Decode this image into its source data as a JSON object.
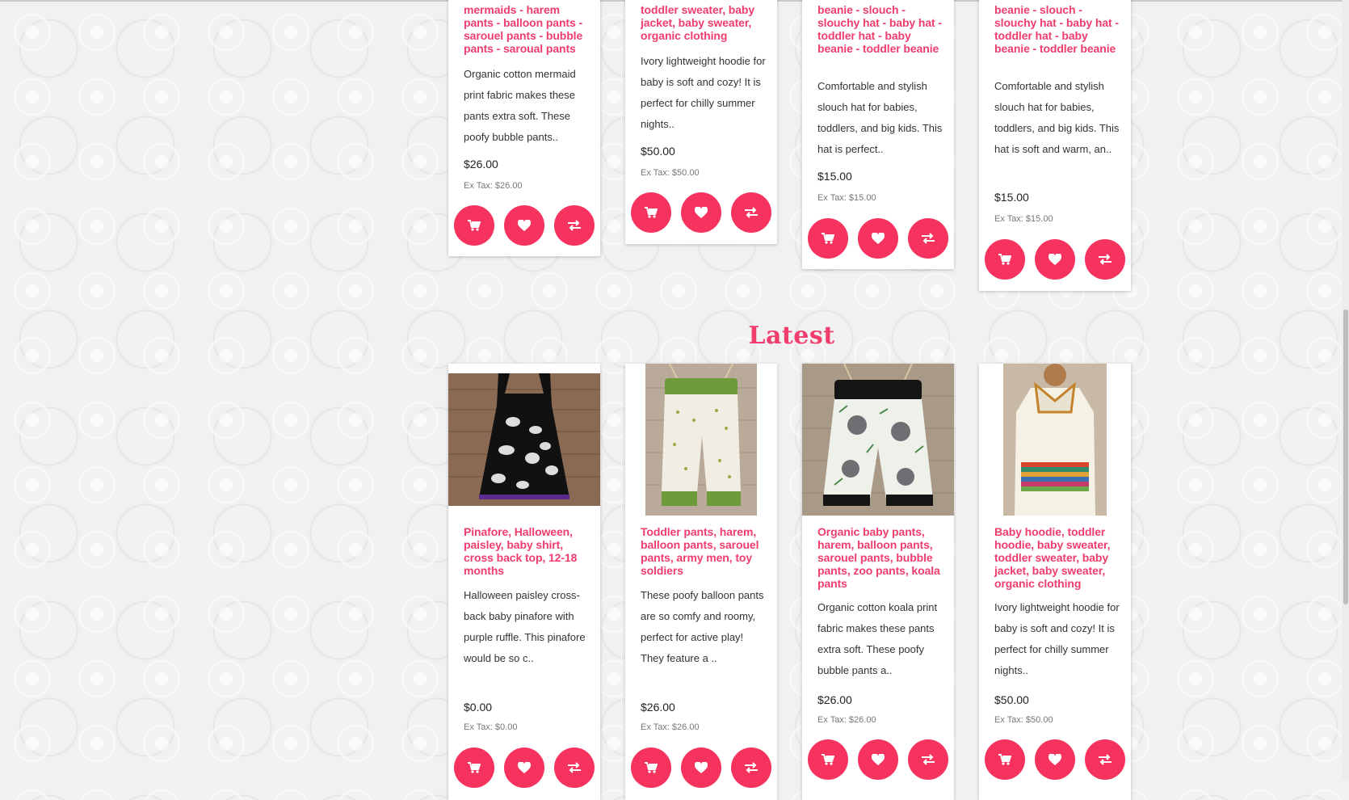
{
  "section_heading": "Latest",
  "colors": {
    "accent": "#f6335f",
    "title": "#f03d6b"
  },
  "top_row": [
    {
      "name_partial": "baby pants - mermaids - harem pants - balloon pants - sarouel pants - bubble pants - saroual pants",
      "name": "mermaids - harem pants - balloon pants - sarouel pants - bubble pants - saroual pants",
      "description": "Organic cotton mermaid print fabric makes these pants extra soft. These poofy bubble pants..",
      "price": "$26.00",
      "ex_tax": "Ex Tax: $26.00"
    },
    {
      "name": "toddler sweater, baby jacket, baby sweater, organic clothing",
      "description": "Ivory lightweight hoodie for baby is soft and cozy! It is perfect for chilly summer nights..",
      "price": "$50.00",
      "ex_tax": "Ex Tax: $50.00"
    },
    {
      "name": "beanie - slouch - slouchy hat - baby hat - toddler hat - baby beanie - toddler beanie",
      "description": "Comfortable and stylish slouch hat for babies, toddlers, and big kids. This hat is perfect..",
      "price": "$15.00",
      "ex_tax": "Ex Tax: $15.00"
    },
    {
      "name": "beanie - slouch - slouchy hat - baby hat - toddler hat - baby beanie - toddler beanie",
      "description": "Comfortable and stylish slouch hat for babies, toddlers, and big kids. This hat is soft and warm, an..",
      "price": "$15.00",
      "ex_tax": "Ex Tax: $15.00"
    }
  ],
  "latest": [
    {
      "name": "Pinafore, Halloween, paisley, baby shirt, cross back top, 12-18 months",
      "description": "Halloween paisley cross-back baby pinafore with purple ruffle. This pinafore would be so c..",
      "price": "$0.00",
      "ex_tax": "Ex Tax: $0.00"
    },
    {
      "name": "Toddler pants, harem, balloon pants, sarouel pants, army men, toy soldiers",
      "description": "These poofy balloon pants are so comfy and roomy, perfect for active play! They feature a ..",
      "price": "$26.00",
      "ex_tax": "Ex Tax: $26.00"
    },
    {
      "name": "Organic baby pants, harem, balloon pants, sarouel pants, bubble pants, zoo pants, koala pants",
      "description": "Organic cotton koala print fabric makes these pants extra soft. These poofy bubble pants a..",
      "price": "$26.00",
      "ex_tax": "Ex Tax: $26.00"
    },
    {
      "name": "Baby hoodie, toddler hoodie, baby sweater, toddler sweater, baby jacket, baby sweater, organic clothing",
      "description": "Ivory lightweight hoodie for baby is soft and cozy! It is perfect for chilly summer nights..",
      "price": "$50.00",
      "ex_tax": "Ex Tax: $50.00"
    }
  ],
  "icons": {
    "cart": "cart-icon",
    "wishlist": "heart-icon",
    "compare": "compare-icon"
  }
}
